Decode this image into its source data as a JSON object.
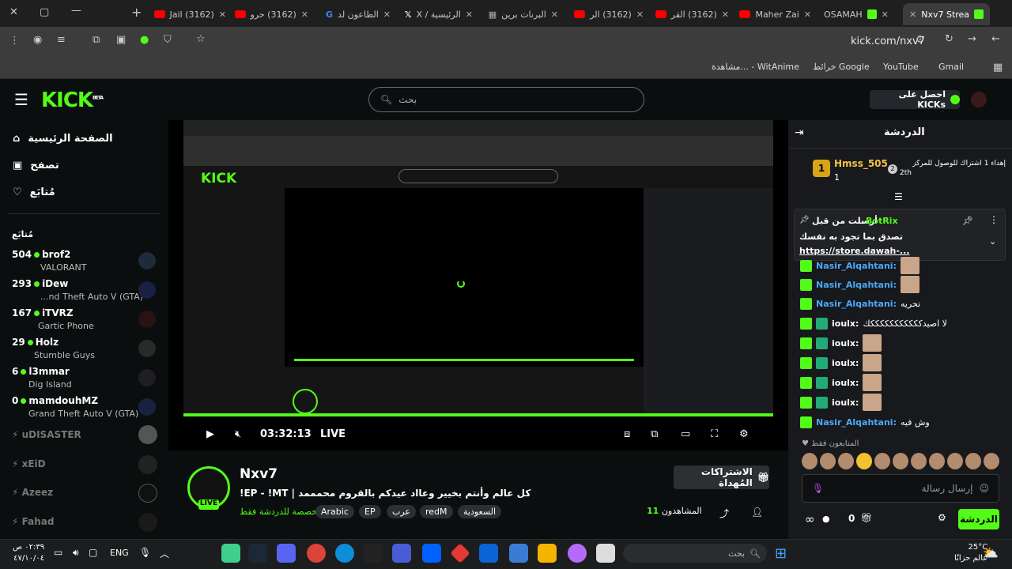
{
  "browser": {
    "tabs": [
      {
        "label": "Nxv7 Strea",
        "icon": "kick",
        "active": true
      },
      {
        "label": "OSAMAH",
        "icon": "kick"
      },
      {
        "label": "Maher Zai",
        "icon": "youtube"
      },
      {
        "label": "(3162) القر",
        "icon": "youtube"
      },
      {
        "label": "(3162) الر",
        "icon": "youtube"
      },
      {
        "label": "البرنات برين",
        "icon": "app"
      },
      {
        "label": "الرئيسية / X",
        "icon": "x"
      },
      {
        "label": "الطاعون لد",
        "icon": "google"
      },
      {
        "label": "(3162) حرو",
        "icon": "youtube"
      },
      {
        "label": "(3162) Jail",
        "icon": "youtube"
      }
    ],
    "url": "kick.com/nxv7",
    "bookmarks": [
      "Gmail",
      "YouTube",
      "خرائط Google",
      "مشاهدة... - WitAnime"
    ]
  },
  "header": {
    "logo": "KICK",
    "logo_sup": "BETA",
    "search_placeholder": "بحث",
    "get_kicks": "احصل على KICKs"
  },
  "sidebar": {
    "nav": [
      {
        "label": "الصفحة الرئيسية",
        "icon": "home-icon"
      },
      {
        "label": "تصفح",
        "icon": "browse-icon"
      },
      {
        "label": "مُتابَع",
        "icon": "heart-icon"
      }
    ],
    "following_title": "مُتابَع",
    "live_channels": [
      {
        "count": "504",
        "name": "brof2",
        "game": "VALORANT"
      },
      {
        "count": "293",
        "name": "iDew",
        "game": "...nd Theft Auto V (GTA)"
      },
      {
        "count": "167",
        "name": "iTVRZ",
        "game": "Gartic Phone"
      },
      {
        "count": "29",
        "name": "Holz",
        "game": "Stumble Guys"
      },
      {
        "count": "6",
        "name": "l3mmar",
        "game": "Dig Island"
      },
      {
        "count": "0",
        "name": "mamdouhMZ",
        "game": "Grand Theft Auto V (GTA)"
      }
    ],
    "offline_channels": [
      "uDISASTER",
      "xEiD",
      "Azeez",
      "Fahad"
    ]
  },
  "player": {
    "time": "03:32:13",
    "live_label": "LIVE"
  },
  "stream": {
    "name": "Nxv7",
    "title": "!EP - !MT | كل عالم وأنتم بخيير وعااد عيدكم بالقروم محمممد",
    "category": "مخصصة للدردشة فقط",
    "tags": [
      "Arabic",
      "EP",
      "عرب",
      "redM",
      "السعودية"
    ],
    "live_badge": "LIVE",
    "gift_button": "الاشتراكات المُهداة",
    "viewers_label": "المشاهدون",
    "viewers_count": "11"
  },
  "chat": {
    "title": "الدردشة",
    "gifter": {
      "name": "Hmss_505",
      "count": "1",
      "rank": "2",
      "text": "إهداء 1 اشتراك للوصول للمركز",
      "rank_text": "2th"
    },
    "pinned": {
      "by": "أرسلت من قبل",
      "user": "BotRix",
      "text": "تصدق بما تجود به نفسك",
      "link": "https://store.dawah-..."
    },
    "messages": [
      {
        "user": "Nasir_Alqahtani:",
        "text": ""
      },
      {
        "user": "Nasir_Alqahtani:",
        "text": ""
      },
      {
        "user": "Nasir_Alqahtani:",
        "text": "تحريه"
      },
      {
        "user": "ioulx:",
        "text": "لا اصيدكككككككككككك"
      },
      {
        "user": "ioulx:",
        "text": ""
      },
      {
        "user": "ioulx:",
        "text": ""
      },
      {
        "user": "ioulx:",
        "text": ""
      },
      {
        "user": "ioulx:",
        "text": ""
      },
      {
        "user": "Nasir_Alqahtani:",
        "text": "وش فيه"
      }
    ],
    "followers_only": "المتابعون فقط",
    "input_placeholder": "إرسال رسالة",
    "kicks_count": "0",
    "send_label": "الدردشة"
  },
  "taskbar": {
    "weather_temp": "25°C",
    "weather_text": "عالم حزانًا",
    "search_placeholder": "بحث",
    "lang": "ENG",
    "time": "٠٢:٣٩ ص",
    "date": "٤٧/١٠/٠٤"
  }
}
